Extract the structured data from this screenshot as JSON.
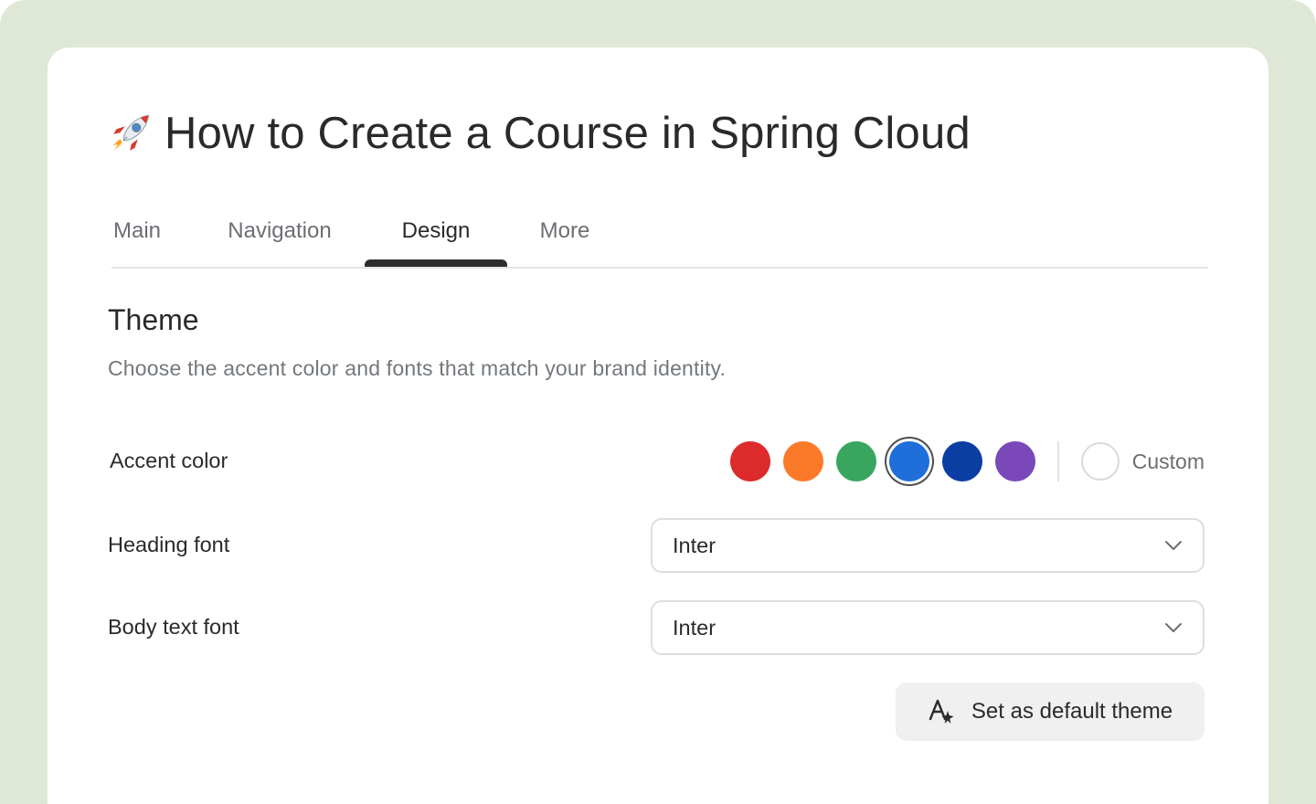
{
  "page": {
    "title_emoji": "rocket-icon",
    "title": "How to Create a Course in Spring Cloud"
  },
  "tabs": [
    {
      "label": "Main",
      "active": false
    },
    {
      "label": "Navigation",
      "active": false
    },
    {
      "label": "Design",
      "active": true
    },
    {
      "label": "More",
      "active": false
    }
  ],
  "theme": {
    "heading": "Theme",
    "description": "Choose the accent color and fonts that match your brand identity.",
    "accent": {
      "label": "Accent color",
      "swatches": [
        {
          "name": "red",
          "color": "#dd2a2a",
          "selected": false
        },
        {
          "name": "orange",
          "color": "#fb7a2a",
          "selected": false
        },
        {
          "name": "green",
          "color": "#3aa55f",
          "selected": false
        },
        {
          "name": "blue",
          "color": "#1f6ed9",
          "selected": true
        },
        {
          "name": "dark-blue",
          "color": "#0b3ea3",
          "selected": false
        },
        {
          "name": "purple",
          "color": "#7a48b8",
          "selected": false
        }
      ],
      "custom_label": "Custom"
    },
    "heading_font": {
      "label": "Heading font",
      "value": "Inter"
    },
    "body_font": {
      "label": "Body text font",
      "value": "Inter"
    },
    "default_button": {
      "label": "Set as default theme",
      "icon": "text-sparkle-icon"
    }
  }
}
